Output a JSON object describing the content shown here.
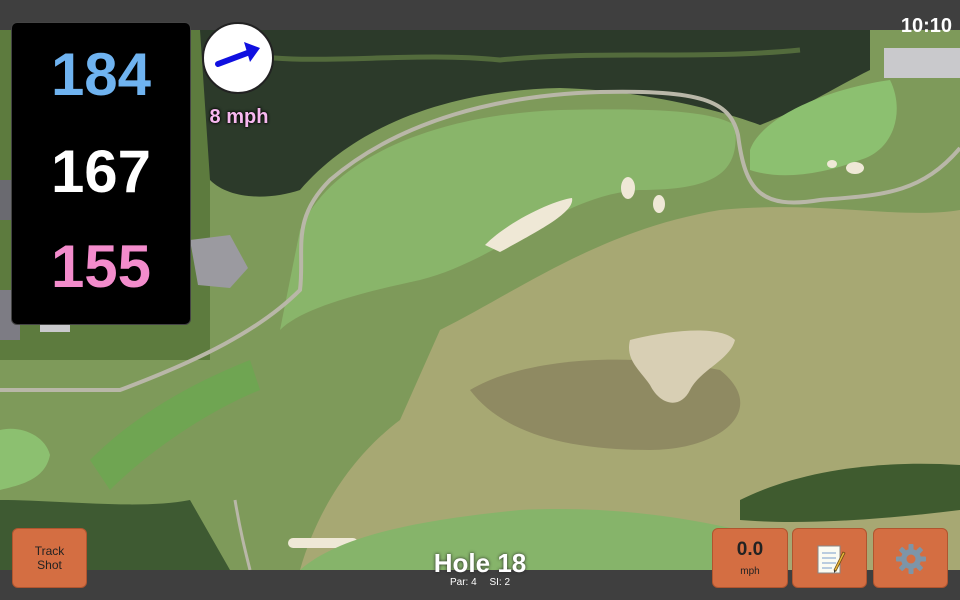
{
  "status": {
    "time": "10:10"
  },
  "distances": {
    "back": "184",
    "middle": "167",
    "front": "155"
  },
  "wind": {
    "speed_text": "8 mph",
    "direction_icon": "arrow-northeast-icon"
  },
  "hole": {
    "title": "Hole 18",
    "par": "Par: 4",
    "stroke_index": "SI: 2"
  },
  "buttons": {
    "track_shot_line1": "Track",
    "track_shot_line2": "Shot",
    "speed_value": "0.0",
    "speed_unit": "mph",
    "notes_icon": "notepad-icon",
    "settings_icon": "gear-icon"
  },
  "colors": {
    "back_distance": "#6fb3f0",
    "middle_distance": "#ffffff",
    "front_distance": "#f38ccc",
    "button_orange": "#d46e42",
    "wind_arrow": "#1010e0"
  }
}
